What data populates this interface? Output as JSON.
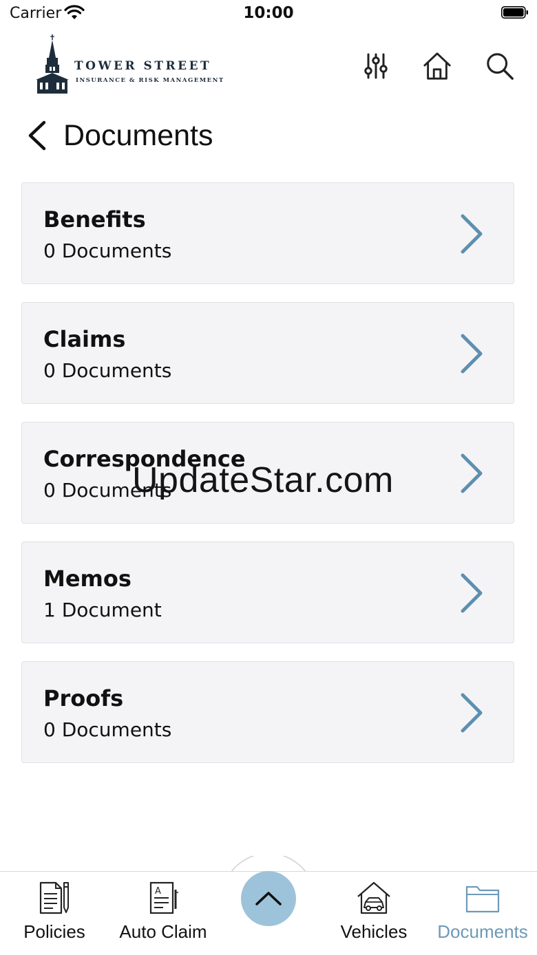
{
  "status_bar": {
    "carrier": "Carrier",
    "time": "10:00"
  },
  "header": {
    "logo_main": "TOWER STREET",
    "logo_sub": "INSURANCE & RISK MANAGEMENT",
    "icons": [
      "filters-icon",
      "home-icon",
      "search-icon"
    ]
  },
  "page": {
    "title": "Documents"
  },
  "categories": [
    {
      "title": "Benefits",
      "count": "0 Documents"
    },
    {
      "title": "Claims",
      "count": "0 Documents"
    },
    {
      "title": "Correspondence",
      "count": "0 Documents"
    },
    {
      "title": "Memos",
      "count": "1 Document"
    },
    {
      "title": "Proofs",
      "count": "0 Documents"
    }
  ],
  "watermark": "UpdateStar.com",
  "tabbar": {
    "tabs": [
      {
        "label": "Policies",
        "icon": "policy-doc-icon"
      },
      {
        "label": "Auto Claim",
        "icon": "claim-form-icon"
      },
      {
        "label": "Vehicles",
        "icon": "garage-car-icon"
      },
      {
        "label": "Documents",
        "icon": "folder-icon",
        "active": true
      }
    ],
    "center_icon": "chevron-up-icon"
  },
  "colors": {
    "accent": "#6d99b7",
    "chevron": "#5e8fb0",
    "center_button": "#9dc3da",
    "card_bg": "#f4f4f7"
  }
}
